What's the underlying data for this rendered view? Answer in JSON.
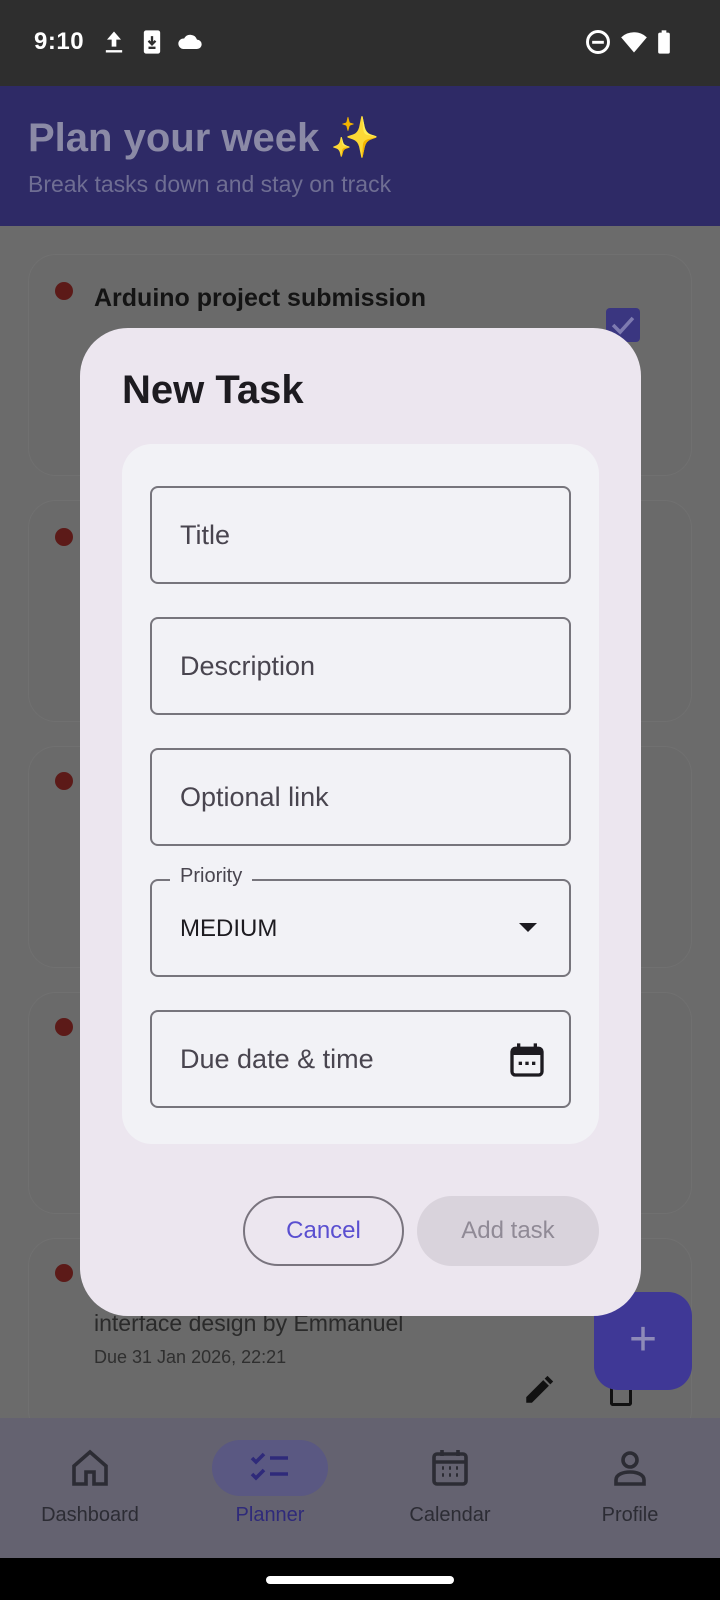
{
  "status_bar": {
    "time": "9:10"
  },
  "header": {
    "title": "Plan your week ✨",
    "subtitle": "Break tasks down and stay on track"
  },
  "background_tasks": {
    "first_title": "Arduino project submission",
    "last_desc": "interface design by Emmanuel",
    "last_due": "Due 31 Jan 2026, 22:21"
  },
  "fab": {
    "label": "+"
  },
  "dialog": {
    "title": "New Task",
    "fields": {
      "title_placeholder": "Title",
      "description_placeholder": "Description",
      "link_placeholder": "Optional link",
      "priority_label": "Priority",
      "priority_value": "MEDIUM",
      "due_placeholder": "Due date & time"
    },
    "cancel_label": "Cancel",
    "add_label": "Add task"
  },
  "bottom_nav": {
    "items": [
      {
        "label": "Dashboard",
        "icon": "home-icon"
      },
      {
        "label": "Planner",
        "icon": "checklist-icon",
        "active": true
      },
      {
        "label": "Calendar",
        "icon": "calendar-icon"
      },
      {
        "label": "Profile",
        "icon": "person-icon"
      }
    ]
  },
  "colors": {
    "accent": "#5a4fd0",
    "header_bg": "#2e2a66",
    "dialog_bg": "#ece6ef",
    "priority_dot": "#5c1a18"
  }
}
